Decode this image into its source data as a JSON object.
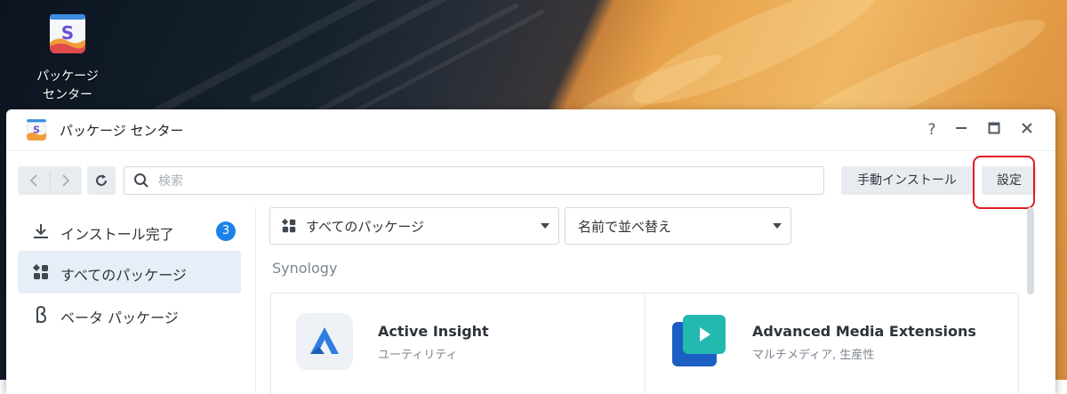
{
  "desktop": {
    "icon_label_line1": "パッケージ",
    "icon_label_line2": "センター"
  },
  "window": {
    "title": "パッケージ センター",
    "controls": {
      "help": "?",
      "minimize": "—",
      "maximize": "▭",
      "close": "✕"
    }
  },
  "toolbar": {
    "search_placeholder": "検索",
    "manual_install_label": "手動インストール",
    "settings_label": "設定"
  },
  "sidebar": {
    "items": [
      {
        "label": "インストール完了",
        "badge": "3",
        "icon": "download-icon"
      },
      {
        "label": "すべてのパッケージ",
        "icon": "grid-icon",
        "active": true
      },
      {
        "label": "ベータ パッケージ",
        "icon": "beta-icon"
      }
    ]
  },
  "filters": {
    "category_selected": "すべてのパッケージ",
    "sort_selected": "名前で並べ替え"
  },
  "section": {
    "title": "Synology"
  },
  "packages": [
    {
      "name": "Active Insight",
      "category": "ユーティリティ",
      "icon": "active-insight-icon"
    },
    {
      "name": "Advanced Media Extensions",
      "category": "マルチメディア, 生産性",
      "icon": "media-extensions-icon"
    }
  ],
  "colors": {
    "accent": "#1b82e8",
    "highlight": "#e11b22",
    "active_bg": "#e6eef8"
  }
}
